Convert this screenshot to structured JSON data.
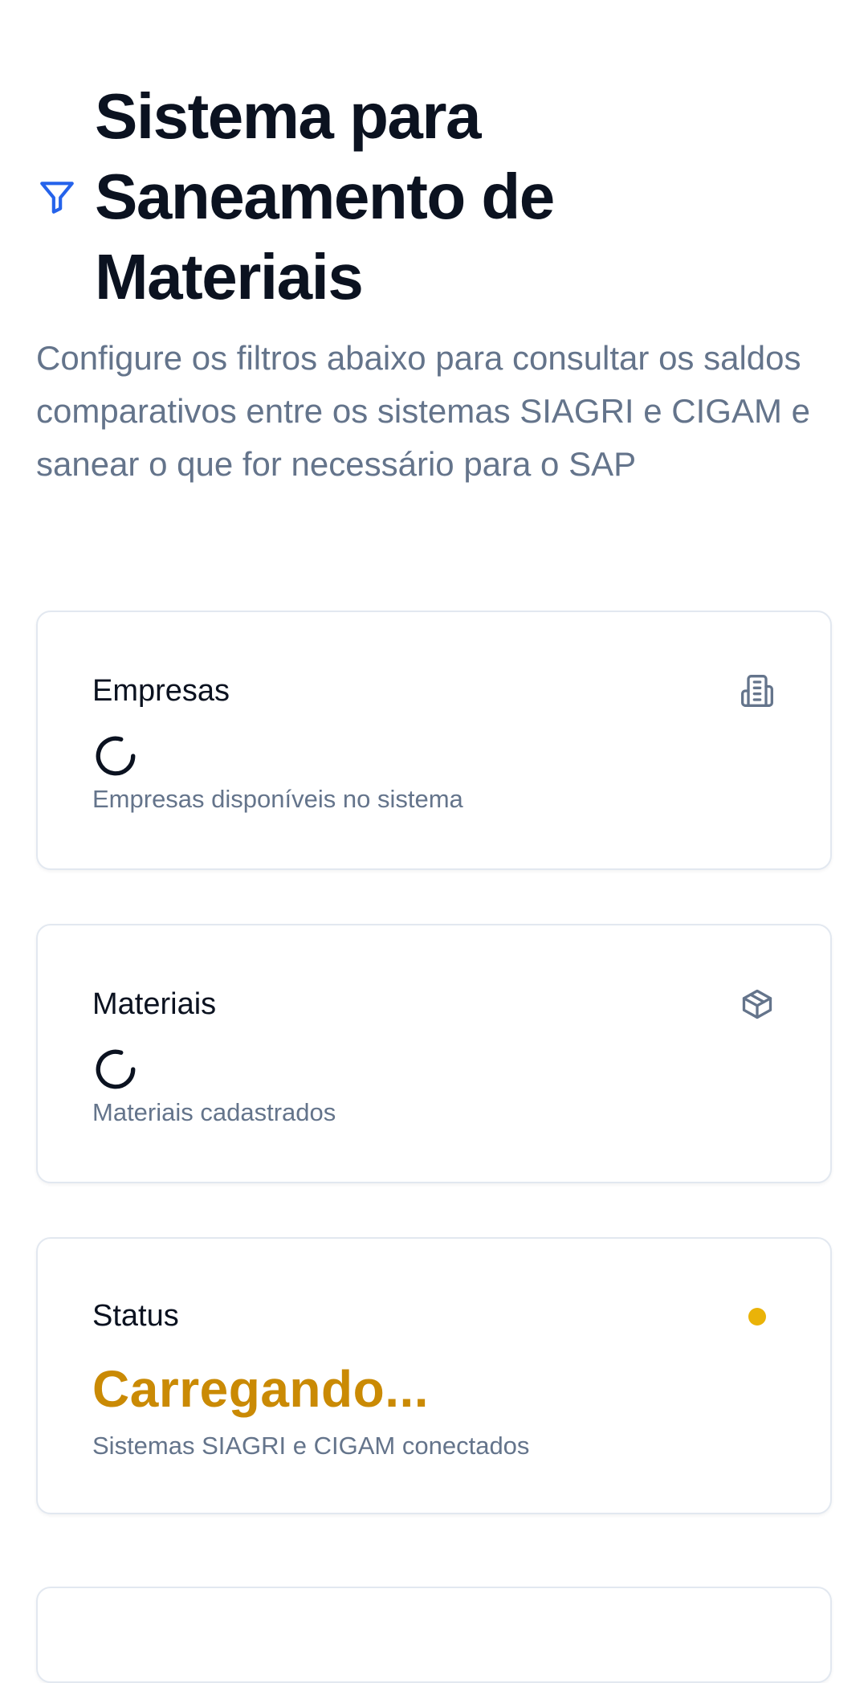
{
  "header": {
    "title": "Sistema para Saneamento de Materiais",
    "subtitle": "Configure os filtros abaixo para consultar os saldos comparativos entre os sistemas SIAGRI e CIGAM e sanear o que for necessário para o SAP",
    "icon": "filter-icon"
  },
  "cards": {
    "empresas": {
      "label": "Empresas",
      "icon": "building-icon",
      "description": "Empresas disponíveis no sistema"
    },
    "materiais": {
      "label": "Materiais",
      "icon": "package-icon",
      "description": "Materiais cadastrados"
    },
    "status": {
      "label": "Status",
      "value": "Carregando...",
      "description": "Sistemas SIAGRI e CIGAM conectados",
      "dot_color": "#eab308"
    }
  },
  "colors": {
    "accent": "#2563eb",
    "status_loading": "#ca8a04",
    "muted_text": "#64748b"
  }
}
